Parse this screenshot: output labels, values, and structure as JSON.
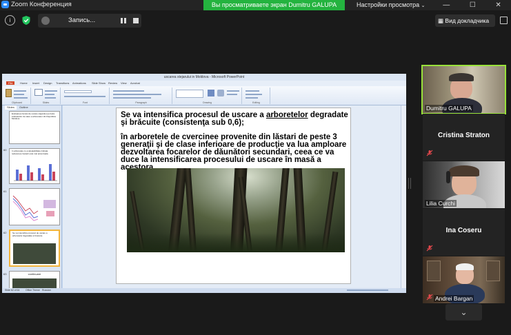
{
  "window": {
    "title": "Zoom Конференция",
    "share_banner": "Вы просматриваете экран Dumitru GALUPA",
    "view_options": "Настройки просмотра",
    "icons": [
      "minimize-icon",
      "maximize-icon",
      "close-icon"
    ]
  },
  "meeting_bar": {
    "recording_label": "Запись...",
    "speaker_view_label": "Вид докладчика",
    "icons": [
      "info-icon",
      "shield-icon",
      "record-icon",
      "pause-icon",
      "stop-icon",
      "fullscreen-icon"
    ]
  },
  "powerpoint": {
    "title": "uscarea stejarului in Moldova - Microsoft PowerPoint",
    "tabs": [
      "File",
      "Home",
      "Insert",
      "Design",
      "Transitions",
      "Animations",
      "Slide Show",
      "Review",
      "View",
      "Acrobat"
    ],
    "ribbon_groups": [
      "Clipboard",
      "Slides",
      "Font",
      "Paragraph",
      "Drawing",
      "Editing"
    ],
    "panel_tabs": [
      "Slides",
      "Outline"
    ],
    "thumbnails": [
      {
        "number": "",
        "text": "Evaluarea riscului de uscare stejarului pe baza indicatorilor de stare a arboretelor din Republica Moldova"
      },
      {
        "number": "60",
        "text": "In arboretele cu exploatabilitate ridicata reducerea cresterii este mai accentuata"
      },
      {
        "number": "61",
        "text": ""
      },
      {
        "number": "62",
        "text": "Se va intensifica procesul de uscare a arboretelor degradate si bracuite"
      },
      {
        "number": "63",
        "text": "continuare"
      }
    ],
    "status_bar": {
      "slide_info": "Slide 62 of 64",
      "theme": "Office Theme",
      "language": "Russian"
    },
    "slide": {
      "para1_before": "Se va intensifica procesul de uscare a ",
      "para1_underlined": "arboretelor",
      "para1_after": " degradate şi brăcuite (consistenţa sub 0,6);",
      "para2": "în arboretele de cvercinee provenite din lăstari de peste 3 generaţii şi de clase inferioare de producţie  va lua amploare dezvoltarea focarelor de dăunători secundari, ceea ce va duce la intensificarea procesului de uscare în masă a acestora."
    }
  },
  "participants": [
    {
      "name": "Dumitru GALUPA",
      "video": true,
      "active_speaker": true
    },
    {
      "name": "Cristina Straton",
      "video": false,
      "muted": true
    },
    {
      "name": "Lilia Curchi",
      "video": true
    },
    {
      "name": "Ina Coseru",
      "video": false,
      "muted": true
    },
    {
      "name": "Andrei Bargan",
      "video": true,
      "muted": true
    }
  ],
  "colors": {
    "share_banner": "#24b33f",
    "active_speaker_border": "#99e23a",
    "muted_icon": "#e5484d",
    "shield_icon": "#22c55e"
  }
}
